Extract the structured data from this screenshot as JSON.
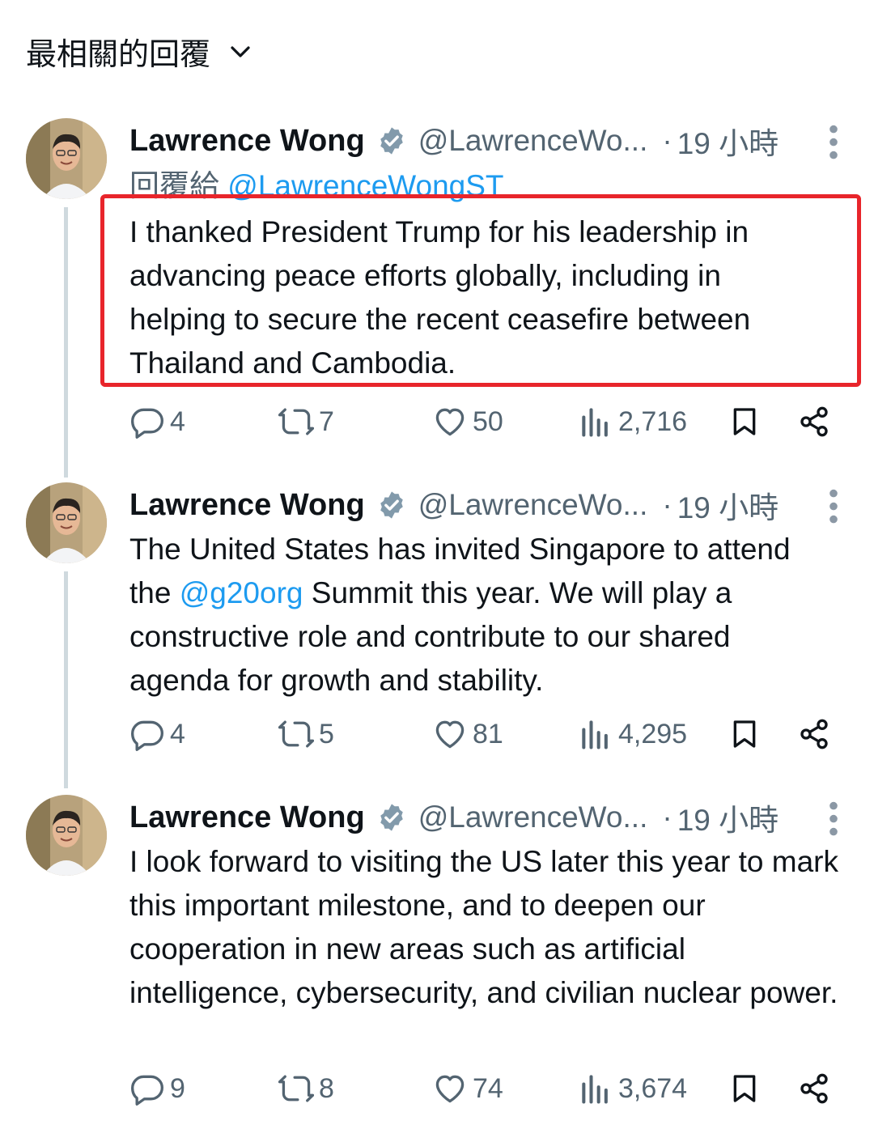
{
  "sort": {
    "label": "最相關的回覆"
  },
  "colors": {
    "accent": "#1d9bf0",
    "muted": "#536471",
    "highlight_border": "#e8252b"
  },
  "tweets": [
    {
      "name": "Lawrence Wong",
      "handle": "@LawrenceWo...",
      "dot": "·",
      "time": "19 小時",
      "reply_prefix": "回覆給",
      "reply_mention": "@LawrenceWongST",
      "text_before": "I thanked President Trump for his leadership in advancing peace efforts globally, including in helping to secure the recent ceasefire between Thailand and Cambodia.",
      "mention": "",
      "text_after": "",
      "highlighted": true,
      "stats": {
        "replies": "4",
        "reposts": "7",
        "likes": "50",
        "views": "2,716"
      }
    },
    {
      "name": "Lawrence Wong",
      "handle": "@LawrenceWo...",
      "dot": "·",
      "time": "19 小時",
      "text_before": "The United States has invited Singapore to attend the ",
      "mention": "@g20org",
      "text_after": " Summit this year. We will play a constructive role and contribute to our shared agenda for growth and stability.",
      "stats": {
        "replies": "4",
        "reposts": "5",
        "likes": "81",
        "views": "4,295"
      }
    },
    {
      "name": "Lawrence Wong",
      "handle": "@LawrenceWo...",
      "dot": "·",
      "time": "19 小時",
      "text_before": "I look forward to visiting the US later this year to mark this important milestone, and to deepen our cooperation in new areas such as artificial intelligence, cybersecurity, and civilian nuclear power.",
      "mention": "",
      "text_after": "",
      "stats": {
        "replies": "9",
        "reposts": "8",
        "likes": "74",
        "views": "3,674"
      }
    }
  ]
}
